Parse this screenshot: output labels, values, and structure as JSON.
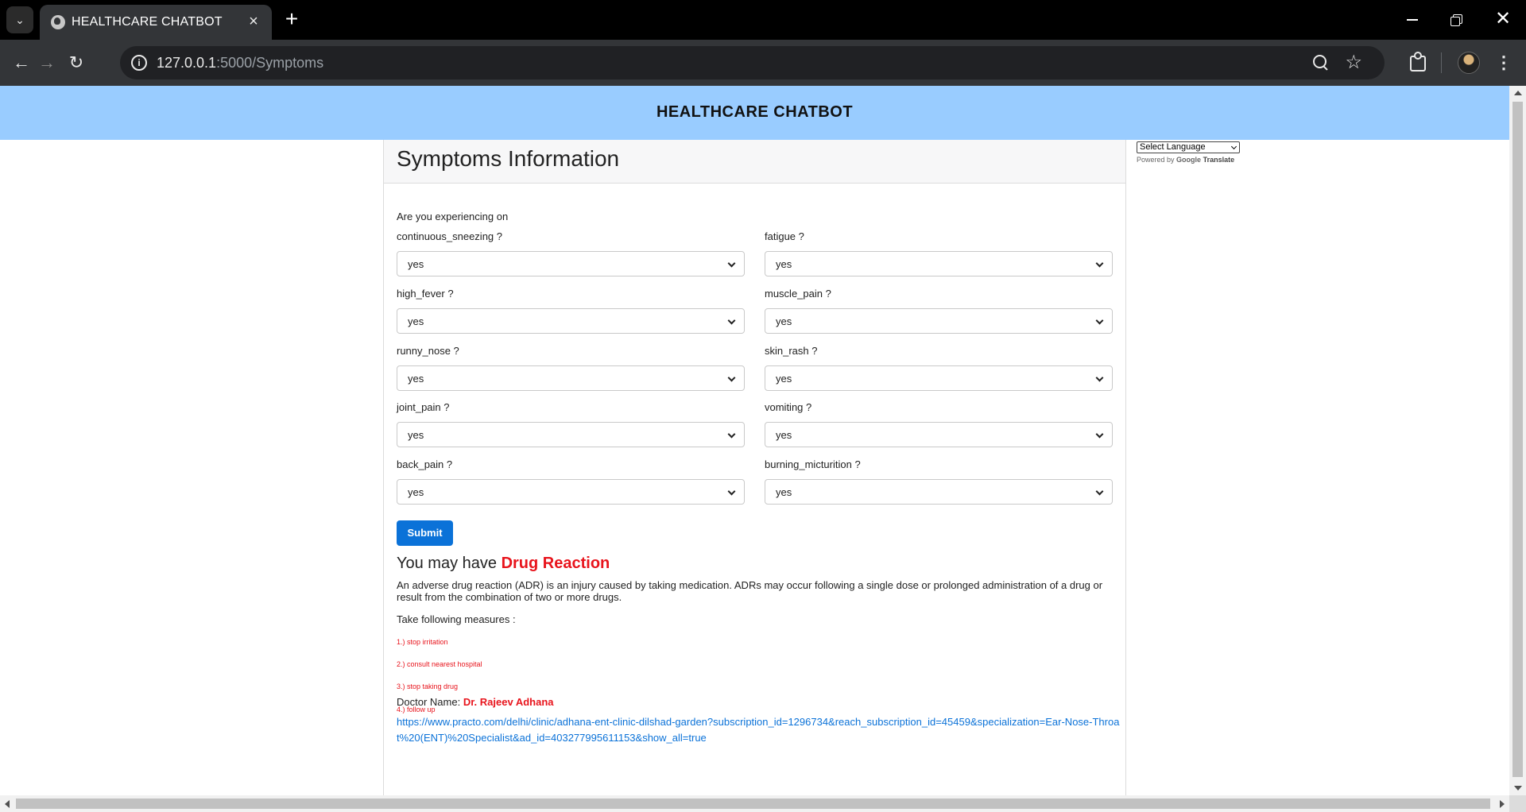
{
  "browser": {
    "tab_title": "HEALTHCARE CHATBOT",
    "url_host": "127.0.0.1",
    "url_rest": ":5000/Symptoms"
  },
  "header": {
    "title": "HEALTHCARE CHATBOT"
  },
  "form": {
    "title": "Symptoms Information",
    "intro": "Are you experiencing on",
    "fields": [
      {
        "label": "continuous_sneezing ?",
        "value": "yes"
      },
      {
        "label": "fatigue ?",
        "value": "yes"
      },
      {
        "label": "high_fever ?",
        "value": "yes"
      },
      {
        "label": "muscle_pain ?",
        "value": "yes"
      },
      {
        "label": "runny_nose ?",
        "value": "yes"
      },
      {
        "label": "skin_rash ?",
        "value": "yes"
      },
      {
        "label": "joint_pain ?",
        "value": "yes"
      },
      {
        "label": "vomiting ?",
        "value": "yes"
      },
      {
        "label": "back_pain ?",
        "value": "yes"
      },
      {
        "label": "burning_micturition ?",
        "value": "yes"
      }
    ],
    "submit_label": "Submit"
  },
  "result": {
    "prefix": "You may have",
    "disease": "Drug Reaction",
    "description": "An adverse drug reaction (ADR) is an injury caused by taking medication. ADRs may occur following a single dose or prolonged administration of a drug or result from the combination of two or more drugs.",
    "measures_label": "Take following measures :",
    "measures": [
      "1.) stop irritation",
      "2.) consult nearest hospital",
      "3.) stop taking drug",
      "4.) follow up"
    ],
    "doctor_label": "Doctor Name:",
    "doctor_name": "Dr. Rajeev Adhana",
    "doctor_link": "https://www.practo.com/delhi/clinic/adhana-ent-clinic-dilshad-garden?subscription_id=1296734&reach_subscription_id=45459&specialization=Ear-Nose-Throat%20(ENT)%20Specialist&ad_id=403277995611153&show_all=true"
  },
  "translate": {
    "select_label": "Select Language",
    "powered_by": "Powered by",
    "google": "Google",
    "translate": "Translate"
  },
  "colors": {
    "header_bg": "#99ccff",
    "accent": "#0b72d8",
    "result_red": "#e8141c"
  }
}
